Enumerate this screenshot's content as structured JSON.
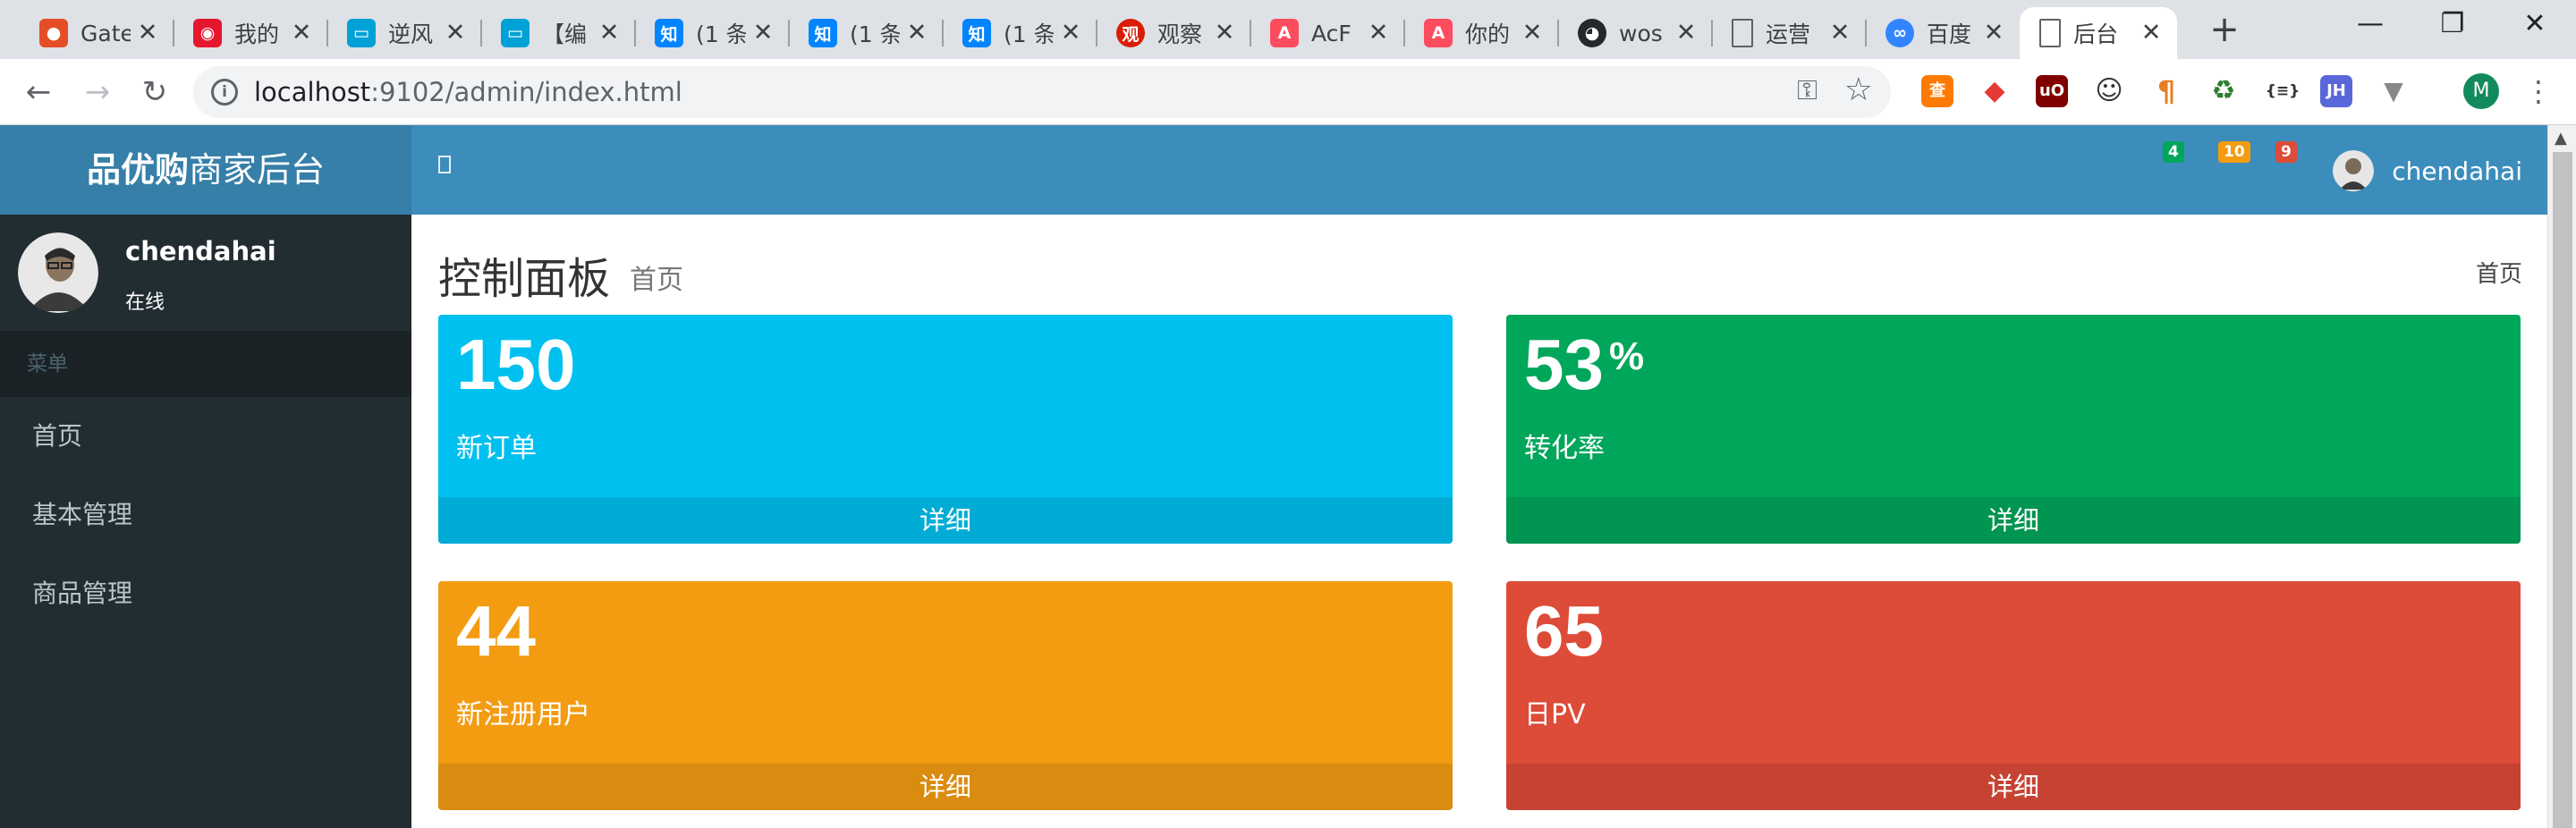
{
  "browser": {
    "tabs": [
      {
        "title": "Gate",
        "icon": "gitee-icon",
        "color": "#e44d26"
      },
      {
        "title": "我的",
        "icon": "weibo-icon",
        "color": "#e6162d"
      },
      {
        "title": "逆风",
        "icon": "bilibili-icon",
        "color": "#00a1d6"
      },
      {
        "title": "【编",
        "icon": "bilibili-icon",
        "color": "#00a1d6"
      },
      {
        "title": "(1 条",
        "icon": "zhihu-icon",
        "color": "#0084ff"
      },
      {
        "title": "(1 条",
        "icon": "zhihu-icon",
        "color": "#0084ff"
      },
      {
        "title": "(1 条",
        "icon": "zhihu-icon",
        "color": "#0084ff"
      },
      {
        "title": "观察",
        "icon": "guancha-icon",
        "color": "#d81e06"
      },
      {
        "title": "AcF",
        "icon": "acfun-icon",
        "color": "#fd4c5d"
      },
      {
        "title": "你的",
        "icon": "acfun-icon",
        "color": "#fd4c5d"
      },
      {
        "title": "wos",
        "icon": "github-icon",
        "color": "#24292e"
      },
      {
        "title": "运营",
        "icon": "document-icon",
        "color": "#ffffff"
      },
      {
        "title": "百度",
        "icon": "baidu-pan-icon",
        "color": "#3385ff"
      },
      {
        "title": "后台",
        "icon": "document-icon",
        "color": "#ffffff"
      }
    ],
    "url_host": "localhost",
    "url_path": ":9102/admin/index.html",
    "extensions": [
      {
        "glyph": "查",
        "color": "#ff7a00"
      },
      {
        "glyph": "◆",
        "color": "#e53935"
      },
      {
        "glyph": "uO",
        "color": "#800000"
      },
      {
        "glyph": "☺",
        "color": "#333333"
      },
      {
        "glyph": "¶",
        "color": "#e67e22"
      },
      {
        "glyph": "♻",
        "color": "#2e7d32"
      },
      {
        "glyph": "{≡}",
        "color": "#555555"
      },
      {
        "glyph": "JH",
        "color": "#5a67d8"
      },
      {
        "glyph": "▼",
        "color": "#888888"
      }
    ],
    "profile_initial": "M"
  },
  "app": {
    "logo_bold": "品优购",
    "logo_rest": "商家后台",
    "toggle_glyph": "",
    "badges": [
      {
        "value": "4",
        "color": "#00a65a"
      },
      {
        "value": "10",
        "color": "#f39c12"
      },
      {
        "value": "9",
        "color": "#dd4b39"
      }
    ],
    "user_name": "chendahai",
    "user_status": "在线",
    "menu_header": "菜单",
    "nav": [
      "首页",
      "基本管理",
      "商品管理"
    ],
    "page_title": "控制面板",
    "page_subtitle": "首页",
    "breadcrumb": "首页",
    "stats": [
      {
        "value": "150",
        "suffix": "",
        "label": "新订单",
        "more": "详细",
        "color": "#00c0ef"
      },
      {
        "value": "53",
        "suffix": "%",
        "label": "转化率",
        "more": "详细",
        "color": "#00a65a"
      },
      {
        "value": "44",
        "suffix": "",
        "label": "新注册用户",
        "more": "详细",
        "color": "#f39c12"
      },
      {
        "value": "65",
        "suffix": "",
        "label": "日PV",
        "more": "详细",
        "color": "#dd4b39"
      }
    ]
  }
}
